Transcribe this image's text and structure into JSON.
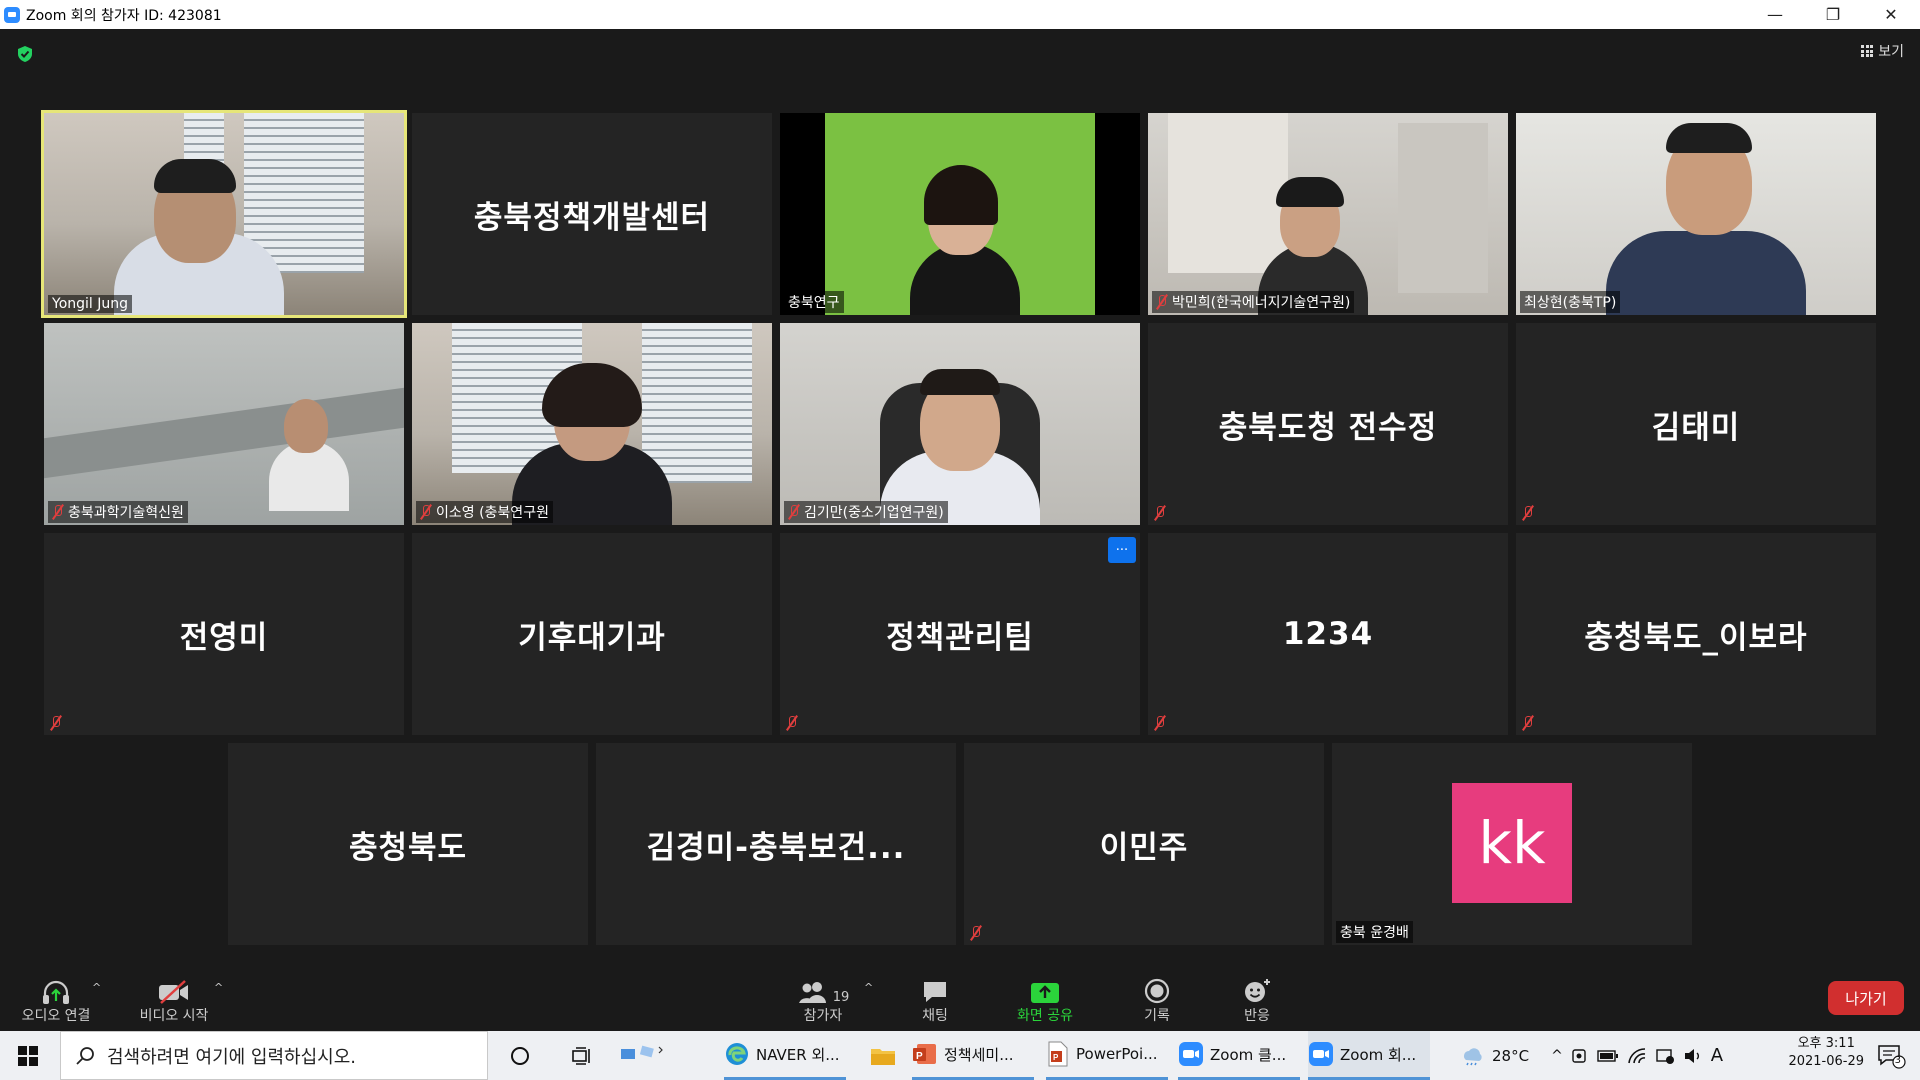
{
  "window": {
    "title": "Zoom 회의 참가자 ID: 423081",
    "controls": [
      "—",
      "❐",
      "✕"
    ]
  },
  "meeting": {
    "view_label": "보기",
    "tiles": [
      {
        "name": "Yongil Jung",
        "kind": "video",
        "muted": false,
        "active": true
      },
      {
        "name": "충북정책개발센터",
        "kind": "name",
        "muted": false,
        "show_label": false
      },
      {
        "name": "충북연구",
        "kind": "video",
        "muted": false
      },
      {
        "name": "박민희(한국에너지기술연구원)",
        "kind": "video",
        "muted": true
      },
      {
        "name": "최상현(충북TP)",
        "kind": "video",
        "muted": false
      },
      {
        "name": "충북과학기술혁신원",
        "kind": "video",
        "muted": true
      },
      {
        "name": "이소영 (충북연구원",
        "kind": "video",
        "muted": true
      },
      {
        "name": "김기만(중소기업연구원)",
        "kind": "video",
        "muted": true
      },
      {
        "name": "충북도청 전수정",
        "kind": "name",
        "muted": true
      },
      {
        "name": "김태미",
        "kind": "name",
        "muted": true
      },
      {
        "name": "전영미",
        "kind": "name",
        "muted": true
      },
      {
        "name": "기후대기과",
        "kind": "name",
        "muted": false
      },
      {
        "name": "정책관리팀",
        "kind": "name",
        "muted": true,
        "more": "···"
      },
      {
        "name": "1234",
        "kind": "name",
        "muted": true
      },
      {
        "name": "충청북도_이보라",
        "kind": "name",
        "muted": true
      },
      {
        "name": "충청북도",
        "kind": "name",
        "muted": false
      },
      {
        "name": "김경미-충북보건...",
        "kind": "name",
        "muted": false
      },
      {
        "name": "이민주",
        "kind": "name",
        "muted": true
      },
      {
        "name": "충북 윤경배",
        "kind": "avatar",
        "initials": "kk",
        "avatar_color": "#e73c7e",
        "muted": false
      }
    ]
  },
  "toolbar": {
    "audio": "오디오 연결",
    "video": "비디오 시작",
    "participants": "참가자",
    "participants_count": "19",
    "chat": "채팅",
    "share": "화면 공유",
    "record": "기록",
    "reactions": "반응",
    "leave": "나가기",
    "share_color": "#2bd43b",
    "leave_color": "#d12f2f"
  },
  "taskbar": {
    "search_placeholder": "검색하려면 여기에 입력하십시오.",
    "apps": [
      {
        "label": "NAVER 외...",
        "icon": "edge-icon"
      },
      {
        "label": "",
        "icon": "folder-icon"
      },
      {
        "label": "정책세미...",
        "icon": "powerpoint-icon"
      },
      {
        "label": "PowerPoi...",
        "icon": "powerpoint-doc-icon"
      },
      {
        "label": "Zoom 클...",
        "icon": "zoom-icon"
      },
      {
        "label": "Zoom 회...",
        "icon": "zoom-icon"
      }
    ],
    "weather": "28°C",
    "ime": "A",
    "time": "오후 3:11",
    "date": "2021-06-29",
    "notifications": "3"
  }
}
